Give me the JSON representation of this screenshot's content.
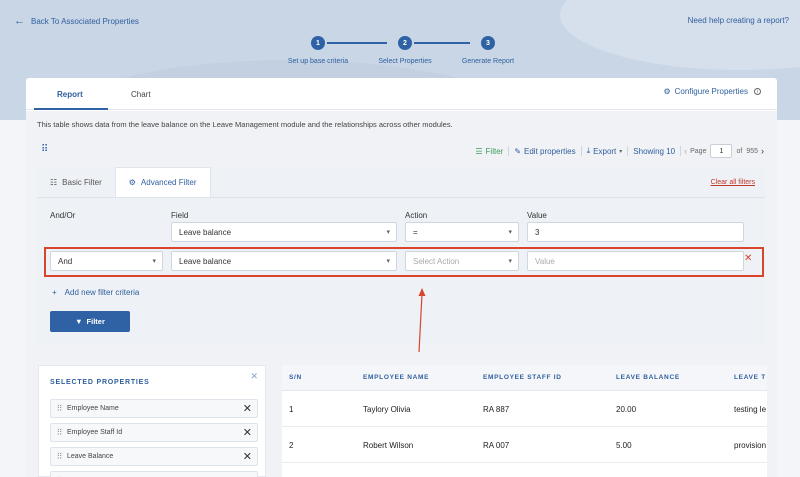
{
  "header": {
    "back_label": "Back To Associated Properties",
    "help_label": "Need help creating a report?"
  },
  "stepper": {
    "steps": [
      {
        "number": "1",
        "label": "Set up base criteria"
      },
      {
        "number": "2",
        "label": "Select Properties"
      },
      {
        "number": "3",
        "label": "Generate Report"
      }
    ]
  },
  "tabs": {
    "report": "Report",
    "chart": "Chart",
    "configure": "Configure Properties"
  },
  "description": "This table shows data from the leave balance on the Leave Management module and the relationships across other modules.",
  "toolbar": {
    "filter": "Filter",
    "edit_properties": "Edit properties",
    "export": "Export",
    "showing": "Showing 10",
    "page_label": "Page",
    "page_value": "1",
    "of_label": "of",
    "total_pages": "955"
  },
  "filter_panel": {
    "basic_tab": "Basic Filter",
    "advanced_tab": "Advanced Filter",
    "clear_all": "Clear all filters",
    "col_andor": "And/Or",
    "col_field": "Field",
    "col_action": "Action",
    "col_value": "Value",
    "row1": {
      "field": "Leave balance",
      "action": "=",
      "value": "3"
    },
    "row2": {
      "andor": "And",
      "field": "Leave balance",
      "action_placeholder": "Select Action",
      "value_placeholder": "Value"
    },
    "add_criteria": "Add new filter criteria",
    "filter_button": "Filter"
  },
  "selected_properties": {
    "title": "SELECTED PROPERTIES",
    "items": [
      "Employee Name",
      "Employee Staff Id",
      "Leave Balance"
    ]
  },
  "table": {
    "headers": [
      "S/N",
      "EMPLOYEE NAME",
      "EMPLOYEE STAFF ID",
      "LEAVE BALANCE",
      "LEAVE T"
    ],
    "rows": [
      [
        "1",
        "Taylory Olivia",
        "RA 887",
        "20.00",
        "testing le"
      ],
      [
        "2",
        "Robert Wilson",
        "RA 007",
        "5.00",
        "provision"
      ]
    ]
  },
  "colors": {
    "primary": "#2f62a5",
    "highlight": "#d9442c",
    "hero": "#c9d6e6"
  }
}
